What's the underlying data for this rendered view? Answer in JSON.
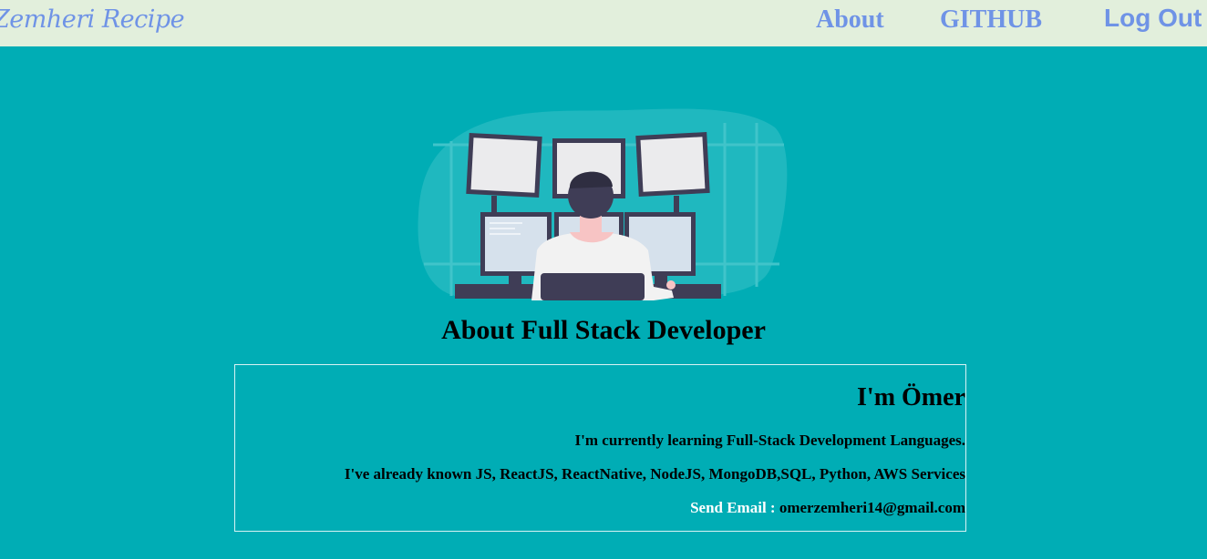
{
  "nav": {
    "brand": "Zemheri Recipe",
    "about_label": "About",
    "github_label": "GITHUB",
    "logout_label": "Log Out"
  },
  "page": {
    "title": "About Full Stack Developer"
  },
  "card": {
    "heading": "I'm Ömer",
    "learning_text": "I'm currently learning Full-Stack Development Languages.",
    "skills_text": "I've already known JS, ReactJS, ReactNative, NodeJS, MongoDB,SQL, Python, AWS Services",
    "email_label": "Send Email : ",
    "email_value": "omerzemheri14@gmail.com"
  },
  "illustration": {
    "icon": "developer-at-monitors-illustration"
  },
  "colors": {
    "background": "#00adb5",
    "navbar": "#e2efdc",
    "nav_text": "#6f93e6"
  }
}
